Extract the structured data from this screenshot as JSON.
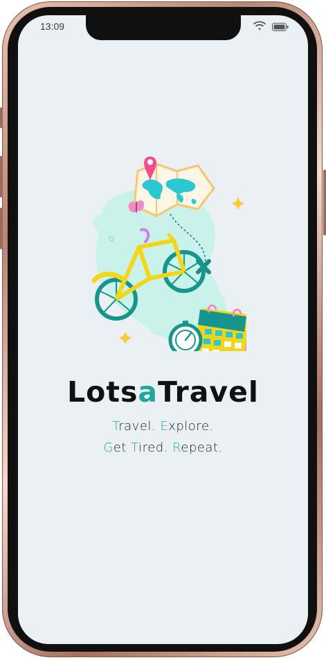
{
  "status_bar": {
    "time": "13:09",
    "wifi_icon": "wifi-icon",
    "battery_icon": "battery-icon"
  },
  "app": {
    "title_part1": "Lots",
    "title_accent": "a",
    "title_part2": "Travel",
    "tagline_line1": [
      {
        "cap": "T",
        "rest": "ravel. "
      },
      {
        "cap": "E",
        "rest": "xplore."
      }
    ],
    "tagline_line2": [
      {
        "cap": "G",
        "rest": "et "
      },
      {
        "cap": "T",
        "rest": "ired. "
      },
      {
        "cap": "R",
        "rest": "epeat."
      }
    ]
  },
  "colors": {
    "accent": "#23a69a",
    "background": "#ebf0f4",
    "text": "#111111"
  }
}
